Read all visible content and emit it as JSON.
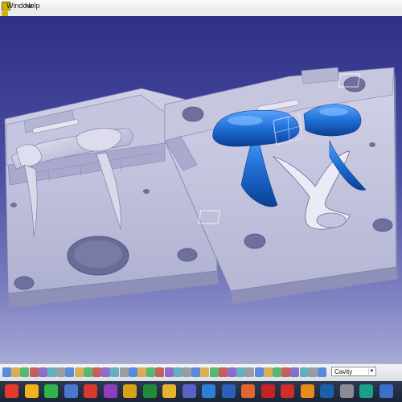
{
  "window": {
    "menu_items": [
      "Window",
      "Help"
    ]
  },
  "app_icon": {
    "name": "catia-app-icon",
    "color": "#d2b400"
  },
  "viewport": {
    "background_top": "#2f2f86",
    "background_bottom": "#a7a9d6",
    "plates": [
      {
        "name": "core-plate",
        "color": "#b8b9d6"
      },
      {
        "name": "cavity-plate",
        "color": "#b8b9d6"
      }
    ],
    "highlight_color": "#1f6fd6"
  },
  "toolbar": {
    "icons": [
      "select-arrow-icon",
      "fly-mode-icon",
      "fit-all-icon",
      "pan-icon",
      "rotate-icon",
      "zoom-in-icon",
      "zoom-out-icon",
      "normal-view-icon",
      "iso-view-icon",
      "shading-icon",
      "hide-show-icon",
      "swap-space-icon",
      "measure-icon",
      "axis-icon",
      "plane-icon",
      "point-icon",
      "line-icon",
      "sketch-icon",
      "extrude-icon",
      "pocket-icon",
      "hole-icon",
      "fillet-icon",
      "chamfer-icon",
      "draft-icon",
      "mirror-icon",
      "pattern-icon",
      "split-icon",
      "join-icon",
      "trim-icon",
      "offset-icon",
      "core-icon",
      "cavity-icon",
      "slider-icon",
      "insert-icon",
      "gate-icon",
      "runner-icon"
    ],
    "combo_value": "Cavity"
  },
  "taskbar": {
    "apps": [
      {
        "name": "start-icon",
        "color": "#e23b2e"
      },
      {
        "name": "chrome-icon",
        "color": "#f2b21b"
      },
      {
        "name": "whatsapp-icon",
        "color": "#2fb44a"
      },
      {
        "name": "files-icon",
        "color": "#4a78d0"
      },
      {
        "name": "calendar-icon",
        "color": "#d63a2e"
      },
      {
        "name": "onenote-icon",
        "color": "#8f3dbf"
      },
      {
        "name": "catia-icon",
        "color": "#d6a21a"
      },
      {
        "name": "excel-icon",
        "color": "#1f8a3a"
      },
      {
        "name": "folder-icon",
        "color": "#e6b52e"
      },
      {
        "name": "teams-icon",
        "color": "#5c61c4"
      },
      {
        "name": "mail-icon",
        "color": "#2d7fd8"
      },
      {
        "name": "word-icon",
        "color": "#2c5fb7"
      },
      {
        "name": "media-icon",
        "color": "#e0672d"
      },
      {
        "name": "pdf-icon",
        "color": "#c72222"
      },
      {
        "name": "solidworks-icon",
        "color": "#cf2c2c"
      },
      {
        "name": "illustrator-icon",
        "color": "#e68b1e"
      },
      {
        "name": "photoshop-icon",
        "color": "#1c5fa8"
      },
      {
        "name": "settings-icon",
        "color": "#8b8b93"
      },
      {
        "name": "edge-icon",
        "color": "#1a9f8b"
      },
      {
        "name": "store-icon",
        "color": "#3a6fcb"
      }
    ]
  }
}
